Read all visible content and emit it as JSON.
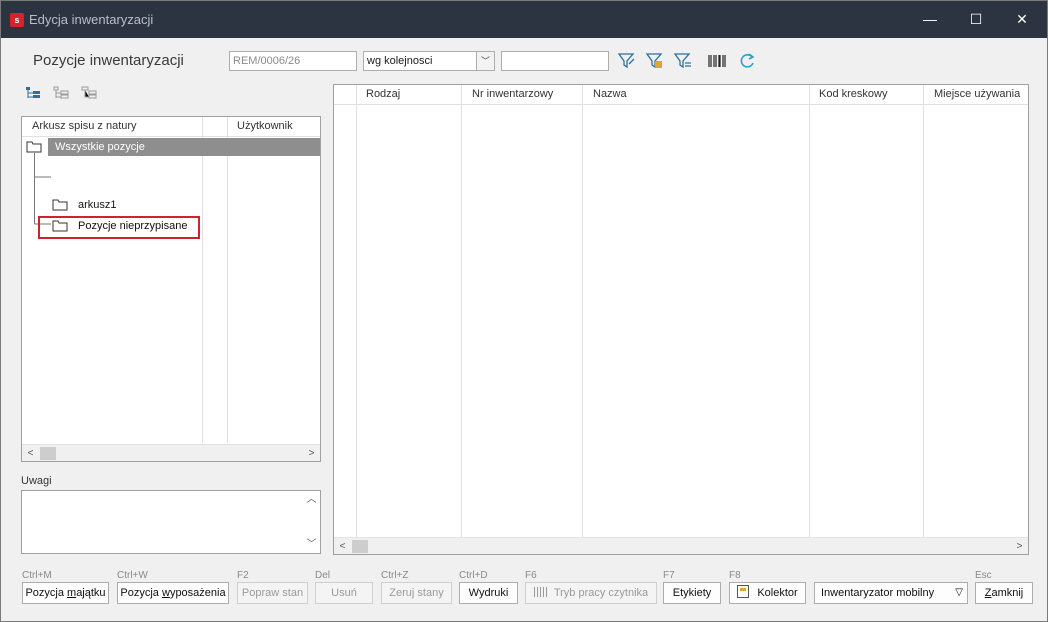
{
  "window": {
    "title": "Edycja inwentaryzacji",
    "minimize": "—",
    "maximize": "☐",
    "close": "✕",
    "app_icon_letter": "s"
  },
  "header": {
    "title": "Pozycje inwentaryzacji",
    "doc_number": "REM/0006/26",
    "sort_value": "wg kolejnosci",
    "search_value": ""
  },
  "tree": {
    "col_sheet": "Arkusz spisu z natury",
    "col_user": "Użytkownik",
    "items": [
      {
        "label": "Wszystkie pozycje"
      },
      {
        "label": "arkusz1"
      },
      {
        "label": "Pozycje nieprzypisane"
      }
    ]
  },
  "notes": {
    "label": "Uwagi",
    "value": ""
  },
  "grid": {
    "columns": [
      "Rodzaj",
      "Nr inwentarzowy",
      "Nazwa",
      "Kod kreskowy",
      "Miejsce używania"
    ]
  },
  "buttons": {
    "add_asset": {
      "shortcut": "Ctrl+M",
      "pre": "Pozycja ",
      "u": "m",
      "post": "ajątku"
    },
    "add_equipment": {
      "shortcut": "Ctrl+W",
      "pre": "Pozycja ",
      "u": "w",
      "post": "yposażenia"
    },
    "fix_state": {
      "shortcut": "F2",
      "label": "Popraw stan"
    },
    "delete": {
      "shortcut": "Del",
      "label": "Usuń"
    },
    "reset_states": {
      "shortcut": "Ctrl+Z",
      "label": "Zeruj stany"
    },
    "printouts": {
      "shortcut": "Ctrl+D",
      "label": "Wydruki"
    },
    "reader_mode": {
      "shortcut": "F6",
      "label": "Tryb pracy czytnika"
    },
    "labels": {
      "shortcut": "F7",
      "label": "Etykiety"
    },
    "collector": {
      "shortcut": "F8",
      "label": "Kolektor"
    },
    "mobile_select": {
      "value": "Inwentaryzator mobilny"
    },
    "close": {
      "shortcut": "Esc",
      "pre": "",
      "u": "Z",
      "post": "amknij"
    }
  }
}
